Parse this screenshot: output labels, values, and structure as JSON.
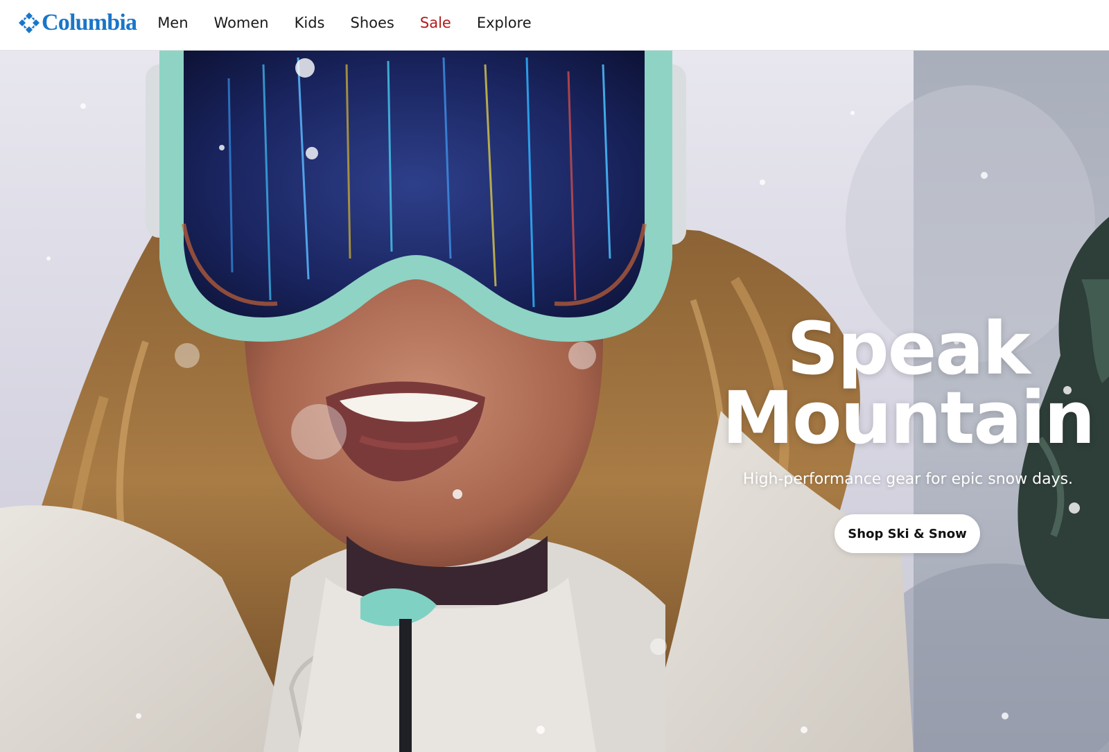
{
  "brand": {
    "name": "Columbia",
    "color": "#1976c8",
    "icon": "columbia-diamond-logo-icon"
  },
  "nav": {
    "items": [
      {
        "label": "Men"
      },
      {
        "label": "Women"
      },
      {
        "label": "Kids"
      },
      {
        "label": "Shoes"
      },
      {
        "label": "Sale",
        "color": "#b31b1b"
      },
      {
        "label": "Explore"
      }
    ]
  },
  "hero": {
    "title_line1": "Speak",
    "title_line2": "Mountain",
    "subtitle": "High-performance gear for epic snow days.",
    "cta_label": "Shop Ski & Snow",
    "image": "Smiling skier wearing mint ski goggles and a white jacket in falling snow"
  }
}
